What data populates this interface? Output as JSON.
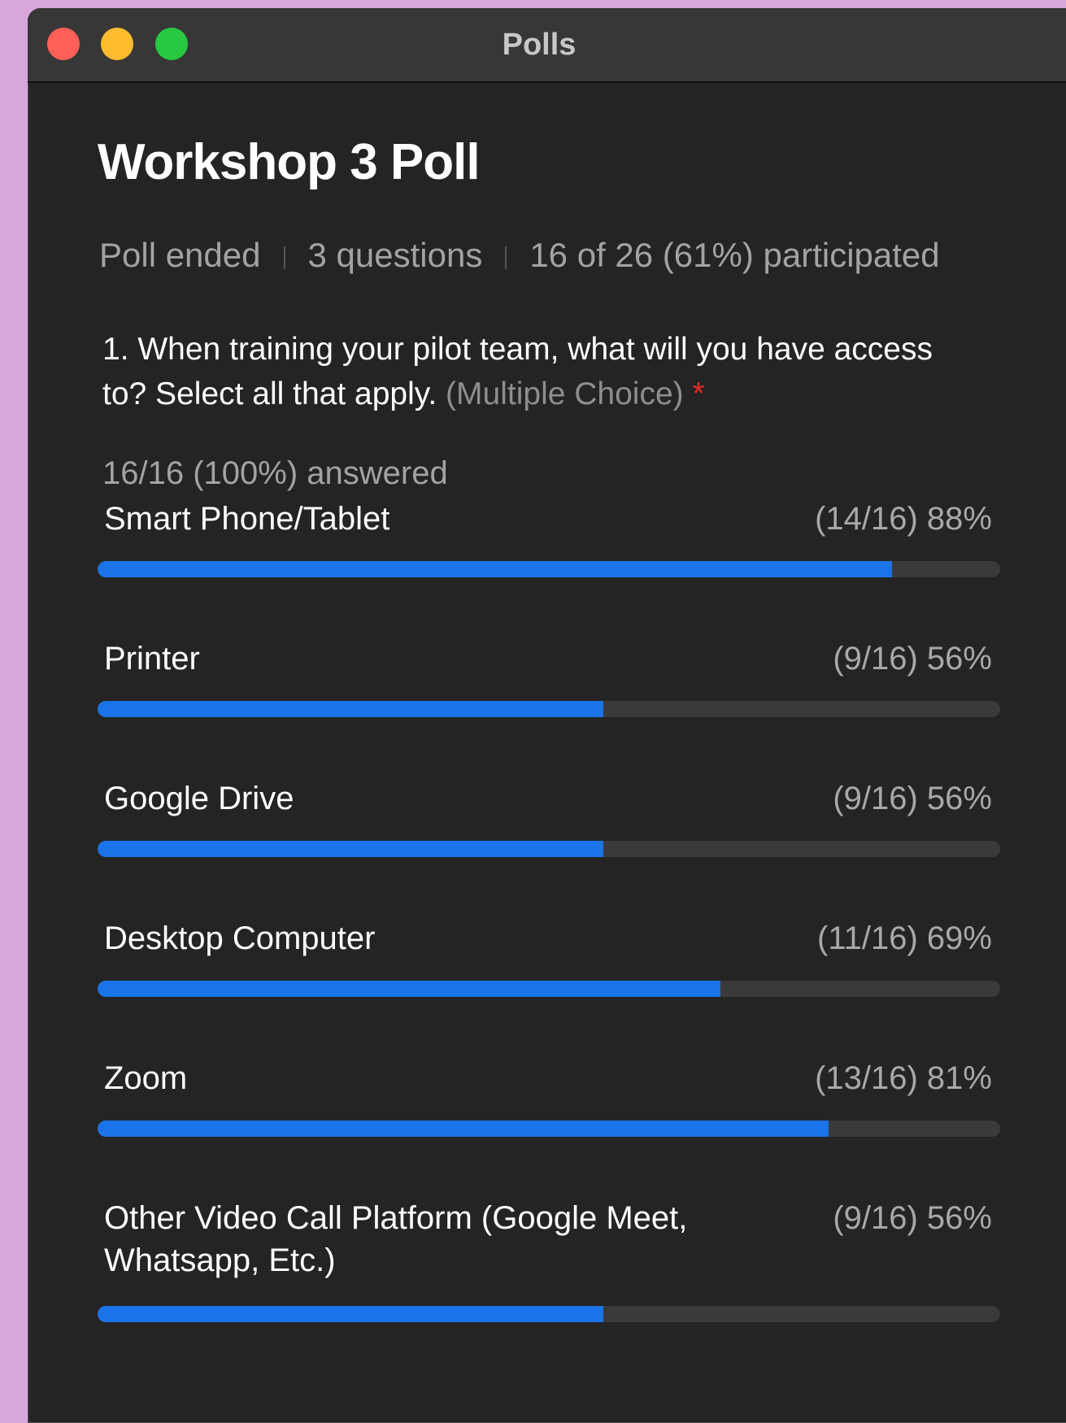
{
  "window": {
    "title": "Polls"
  },
  "poll": {
    "title": "Workshop 3 Poll",
    "status": "Poll ended",
    "questions_count": "3 questions",
    "participation": "16 of 26 (61%) participated"
  },
  "question": {
    "text": "1. When training your pilot team, what will you have access to? Select all that apply.",
    "type": "(Multiple Choice)",
    "required_mark": "*",
    "answered": "16/16 (100%) answered"
  },
  "options": [
    {
      "label": "Smart Phone/Tablet",
      "count": "(14/16) 88%",
      "fraction": 0.88
    },
    {
      "label": "Printer",
      "count": "(9/16) 56%",
      "fraction": 0.56
    },
    {
      "label": "Google Drive",
      "count": "(9/16) 56%",
      "fraction": 0.56
    },
    {
      "label": "Desktop Computer",
      "count": "(11/16) 69%",
      "fraction": 0.69
    },
    {
      "label": "Zoom",
      "count": "(13/16) 81%",
      "fraction": 0.81
    },
    {
      "label": "Other Video Call Platform (Google Meet, Whatsapp, Etc.)",
      "count": "(9/16) 56%",
      "fraction": 0.56
    }
  ],
  "colors": {
    "bar_fill": "#1a73e8",
    "bar_track": "#3a3a3a",
    "required": "#e0302a"
  }
}
